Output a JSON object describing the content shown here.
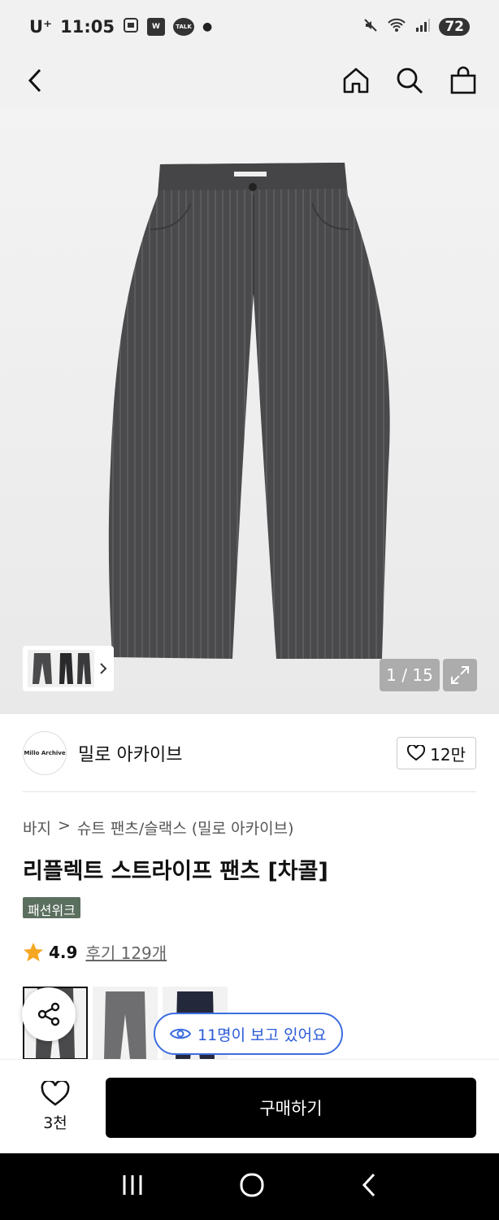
{
  "status_bar": {
    "carrier": "U⁺",
    "time": "11:05",
    "kakao_label": "TALK",
    "battery": "72"
  },
  "hero": {
    "counter": "1 / 15"
  },
  "brand": {
    "logo_text": "Millo Archive",
    "name": "밀로 아카이브",
    "likes": "12만"
  },
  "breadcrumb": {
    "category": "바지",
    "separator": ">",
    "subcategory": "슈트 팬츠/슬랙스 (밀로 아카이브)"
  },
  "product": {
    "title": "리플렉트 스트라이프 팬츠 [차콜]",
    "tag": "패션위크",
    "rating": "4.9",
    "reviews": "후기 129개",
    "viewers": "11명이 보고 있어요"
  },
  "bottom_bar": {
    "wish_count": "3천",
    "buy_label": "구매하기"
  },
  "colors": {
    "pants": "#4a4a4c",
    "viewer_accent": "#3d6de1",
    "star": "#f5a623",
    "tag_bg": "#5b6f5e"
  }
}
